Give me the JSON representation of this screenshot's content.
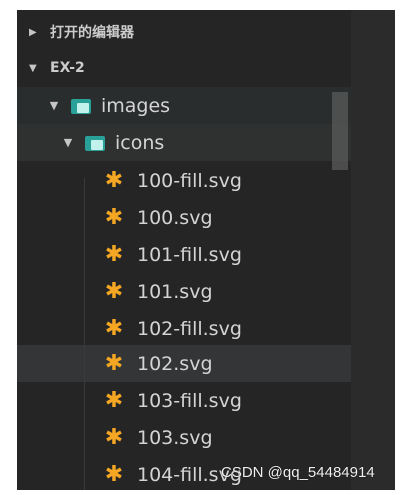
{
  "sections": {
    "open_editors": {
      "label": "打开的编辑器",
      "expanded": false
    },
    "workspace": {
      "label": "EX-2",
      "expanded": true
    }
  },
  "toolbar": {
    "icons": [
      "new-file-icon",
      "new-folder-icon",
      "refresh-icon",
      "collapse-all-icon"
    ]
  },
  "tree": {
    "images_folder": "images",
    "icons_folder": "icons",
    "files": [
      "100-fill.svg",
      "100.svg",
      "101-fill.svg",
      "101.svg",
      "102-fill.svg",
      "102.svg",
      "103-fill.svg",
      "103.svg",
      "104-fill.svg"
    ]
  },
  "colors": {
    "panel_bg": "#252526",
    "folder_icon": "#2aa198",
    "file_icon": "#f5a623",
    "text": "#d4d4d4"
  },
  "watermark": "CSDN @qq_54484914"
}
